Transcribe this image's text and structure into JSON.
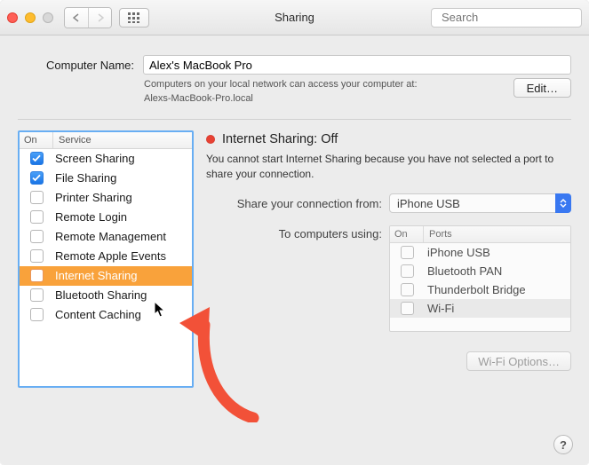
{
  "window": {
    "title": "Sharing"
  },
  "search": {
    "placeholder": "Search"
  },
  "computer": {
    "label": "Computer Name:",
    "value": "Alex's MacBook Pro",
    "hint_line1": "Computers on your local network can access your computer at:",
    "hint_line2": "Alexs-MacBook-Pro.local",
    "edit_label": "Edit…"
  },
  "services": {
    "columns": {
      "on": "On",
      "service": "Service"
    },
    "items": [
      {
        "label": "Screen Sharing",
        "checked": true,
        "selected": false
      },
      {
        "label": "File Sharing",
        "checked": true,
        "selected": false
      },
      {
        "label": "Printer Sharing",
        "checked": false,
        "selected": false
      },
      {
        "label": "Remote Login",
        "checked": false,
        "selected": false
      },
      {
        "label": "Remote Management",
        "checked": false,
        "selected": false
      },
      {
        "label": "Remote Apple Events",
        "checked": false,
        "selected": false
      },
      {
        "label": "Internet Sharing",
        "checked": false,
        "selected": true
      },
      {
        "label": "Bluetooth Sharing",
        "checked": false,
        "selected": false
      },
      {
        "label": "Content Caching",
        "checked": false,
        "selected": false
      }
    ]
  },
  "detail": {
    "status_title": "Internet Sharing: Off",
    "status_desc": "You cannot start Internet Sharing because you have not selected a port to share your connection.",
    "share_from_label": "Share your connection from:",
    "share_from_value": "iPhone USB",
    "to_label": "To computers using:",
    "ports_columns": {
      "on": "On",
      "ports": "Ports"
    },
    "ports": [
      {
        "label": "iPhone USB",
        "checked": false
      },
      {
        "label": "Bluetooth PAN",
        "checked": false
      },
      {
        "label": "Thunderbolt Bridge",
        "checked": false
      },
      {
        "label": "Wi-Fi",
        "checked": false
      }
    ],
    "wifi_options_label": "Wi-Fi Options…"
  },
  "help": {
    "label": "?"
  }
}
